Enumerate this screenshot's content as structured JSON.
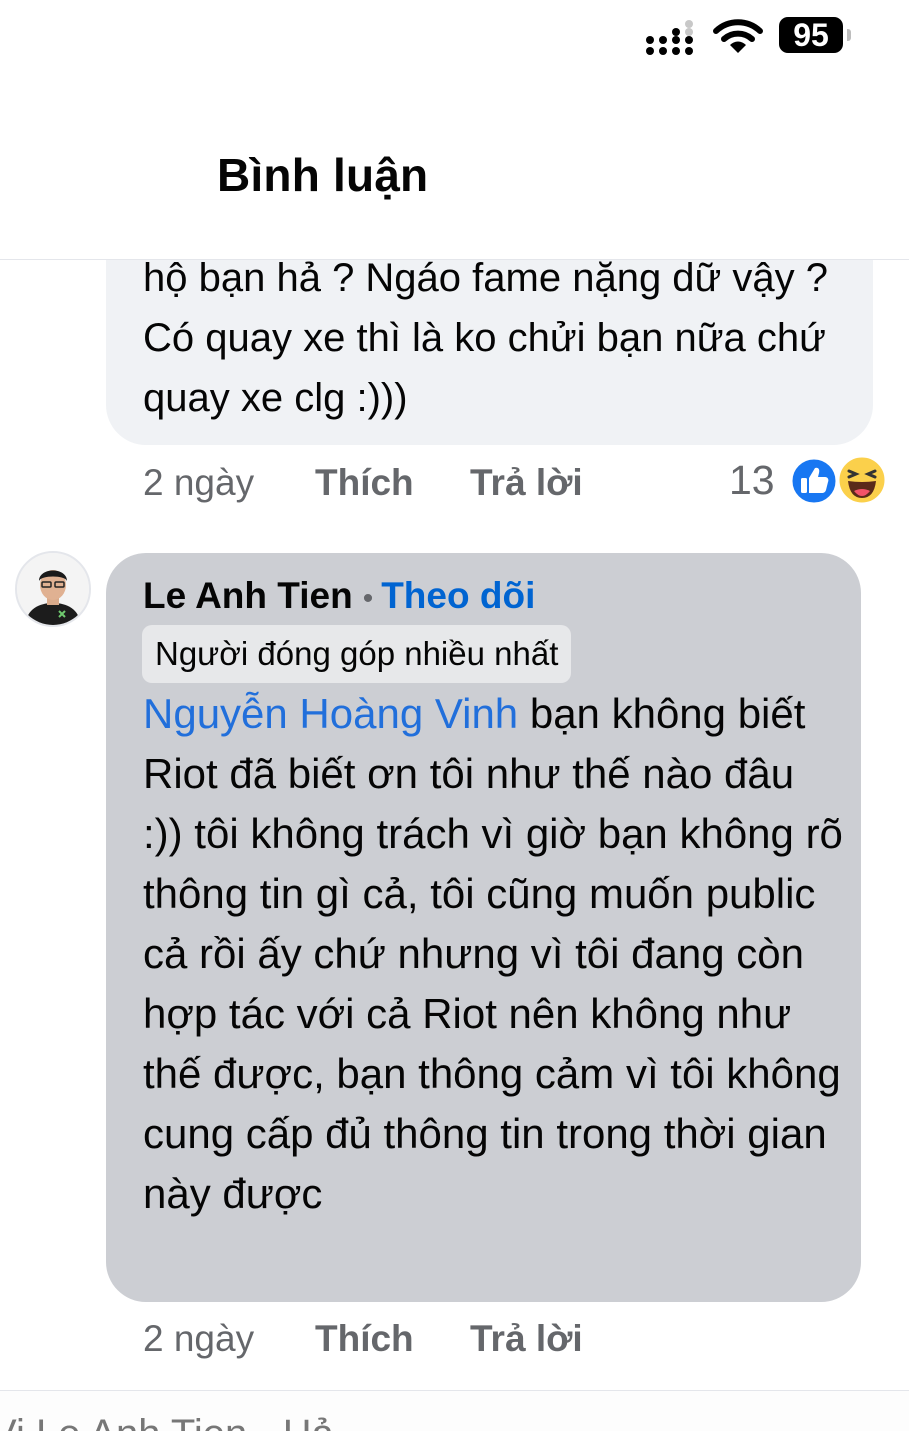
{
  "status_bar": {
    "battery": "95"
  },
  "header": {
    "title": "Bình luận"
  },
  "comment_1": {
    "text": "hộ bạn hả ? Ngáo fame nặng dữ vậy ? Có quay xe thì là ko chửi bạn nữa chứ quay xe clg :)))",
    "time": "2 ngày",
    "like_label": "Thích",
    "reply_label": "Trả lời",
    "reaction_count": "13",
    "reactions": [
      "like-icon",
      "haha-icon"
    ]
  },
  "comment_2": {
    "author": "Le Anh Tien",
    "follow_label": "Theo dõi",
    "badge": "Người đóng góp nhiều nhất",
    "mention": "Nguyễn Hoàng Vinh",
    "text": " bạn không biết Riot đã biết ơn tôi như thế nào đâu :)) tôi không trách vì giờ bạn không rõ thông tin gì cả, tôi cũng muốn public cả rồi ấy chứ nhưng vì tôi đang còn hợp tác với cả Riot nên không như thế được, bạn thông cảm vì tôi không cung cấp đủ thông tin trong thời gian này được",
    "time": "2 ngày",
    "like_label": "Thích",
    "reply_label": "Trả lời"
  },
  "next_row": {
    "partial_text": "Vi Le Anh Tien · Hả"
  },
  "colors": {
    "link": "#0064d1",
    "mention": "#216fdb",
    "meta": "#65676b",
    "bubble_1": "#f0f2f5",
    "bubble_2": "#ccced3"
  }
}
